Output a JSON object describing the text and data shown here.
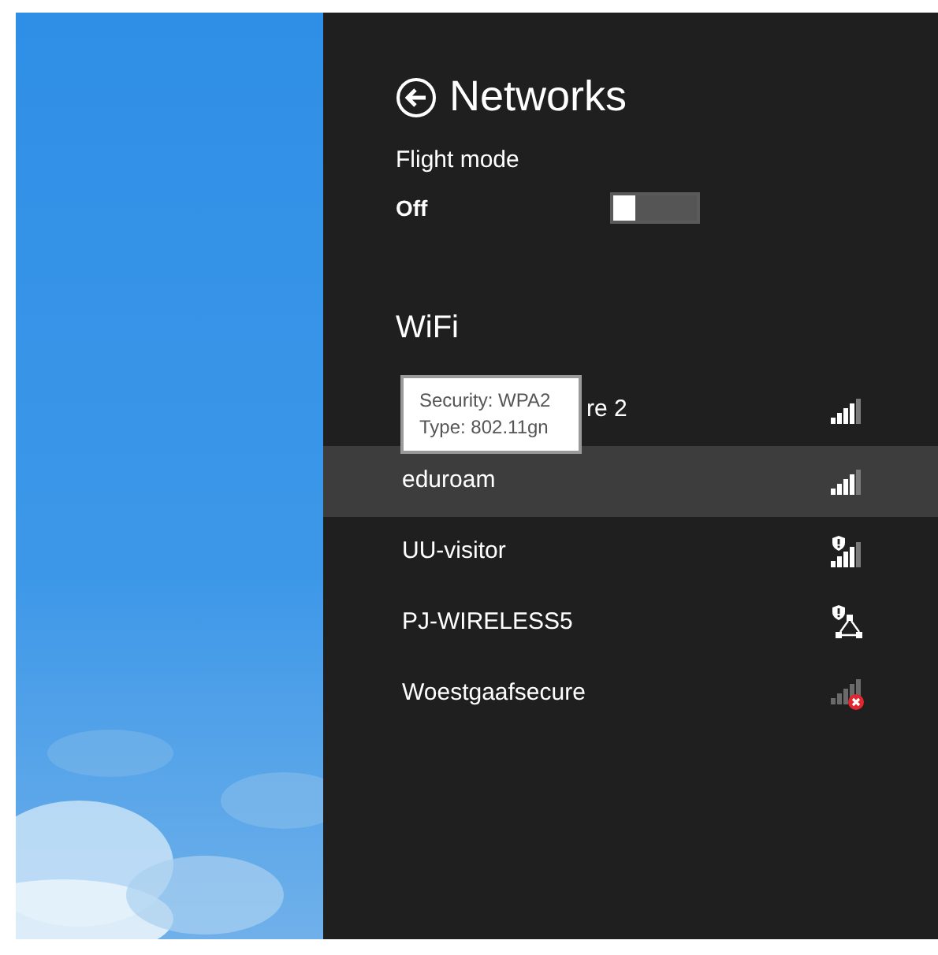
{
  "panel": {
    "title": "Networks",
    "flight_mode": {
      "label": "Flight mode",
      "value": "Off",
      "on": false
    }
  },
  "wifi": {
    "heading": "WiFi",
    "networks": [
      {
        "name": "re 2",
        "kind": "signal",
        "selected": false
      },
      {
        "name": "eduroam",
        "kind": "signal",
        "selected": true
      },
      {
        "name": "UU-visitor",
        "kind": "signal-shield",
        "selected": false
      },
      {
        "name": "PJ-WIRELESS5",
        "kind": "adhoc-shield",
        "selected": false
      },
      {
        "name": "Woestgaafsecure",
        "kind": "signal-error",
        "selected": false
      }
    ],
    "tooltip": {
      "lines": [
        "Security: WPA2",
        "Type: 802.11gn"
      ]
    }
  }
}
